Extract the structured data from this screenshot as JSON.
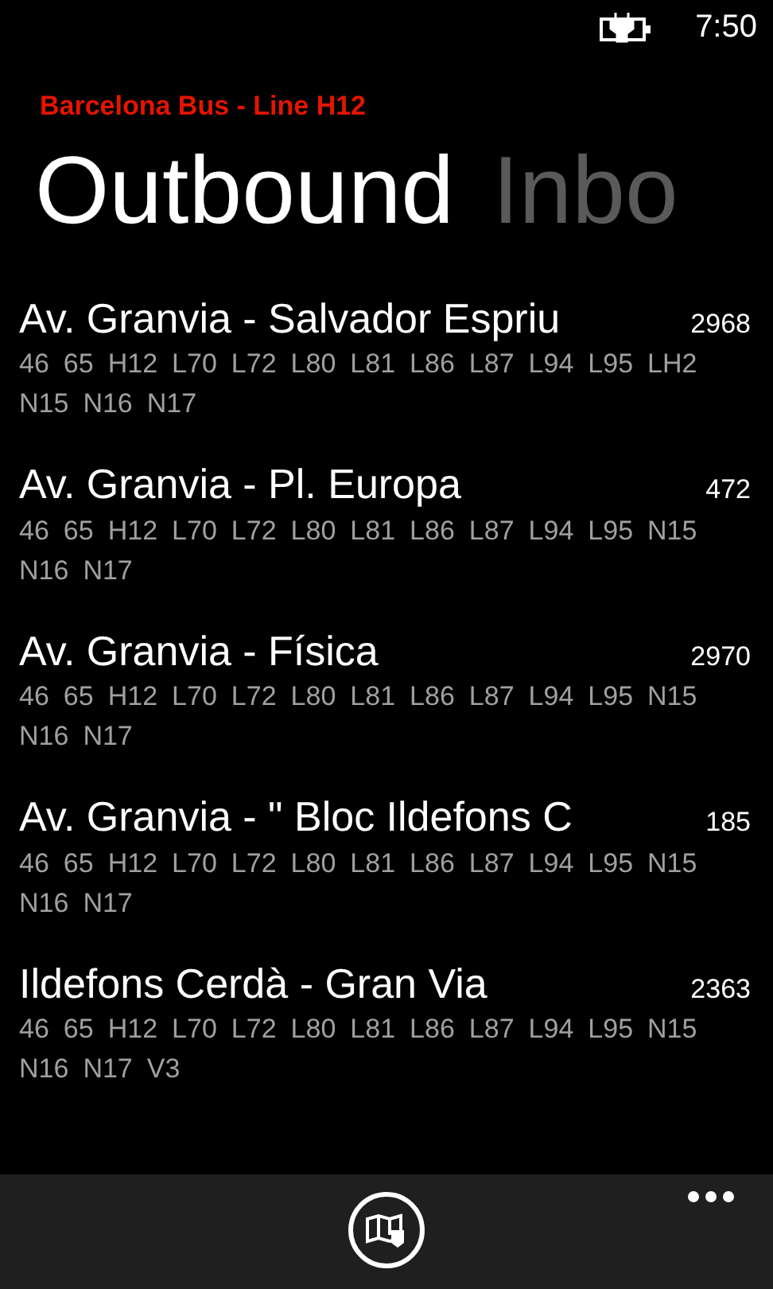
{
  "status_bar": {
    "time": "7:50"
  },
  "app_title": "Barcelona Bus - Line H12",
  "pivot": [
    {
      "label": "Outbound",
      "selected": true
    },
    {
      "label": "Inbo",
      "selected": false
    }
  ],
  "stops": [
    {
      "name": "Av. Granvia - Salvador Espriu",
      "code": "2968",
      "lines": [
        "46",
        "65",
        "H12",
        "L70",
        "L72",
        "L80",
        "L81",
        "L86",
        "L87",
        "L94",
        "L95",
        "LH2",
        "N15",
        "N16",
        "N17"
      ]
    },
    {
      "name": "Av. Granvia - Pl. Europa",
      "code": "472",
      "lines": [
        "46",
        "65",
        "H12",
        "L70",
        "L72",
        "L80",
        "L81",
        "L86",
        "L87",
        "L94",
        "L95",
        "N15",
        "N16",
        "N17"
      ]
    },
    {
      "name": "Av. Granvia - Física",
      "code": "2970",
      "lines": [
        "46",
        "65",
        "H12",
        "L70",
        "L72",
        "L80",
        "L81",
        "L86",
        "L87",
        "L94",
        "L95",
        "N15",
        "N16",
        "N17"
      ]
    },
    {
      "name": "Av. Granvia - \" Bloc Ildefons C",
      "code": "185",
      "lines": [
        "46",
        "65",
        "H12",
        "L70",
        "L72",
        "L80",
        "L81",
        "L86",
        "L87",
        "L94",
        "L95",
        "N15",
        "N16",
        "N17"
      ]
    },
    {
      "name": "Ildefons Cerdà - Gran Via",
      "code": "2363",
      "lines": [
        "46",
        "65",
        "H12",
        "L70",
        "L72",
        "L80",
        "L81",
        "L86",
        "L87",
        "L94",
        "L95",
        "N15",
        "N16",
        "N17",
        "V3"
      ]
    }
  ]
}
